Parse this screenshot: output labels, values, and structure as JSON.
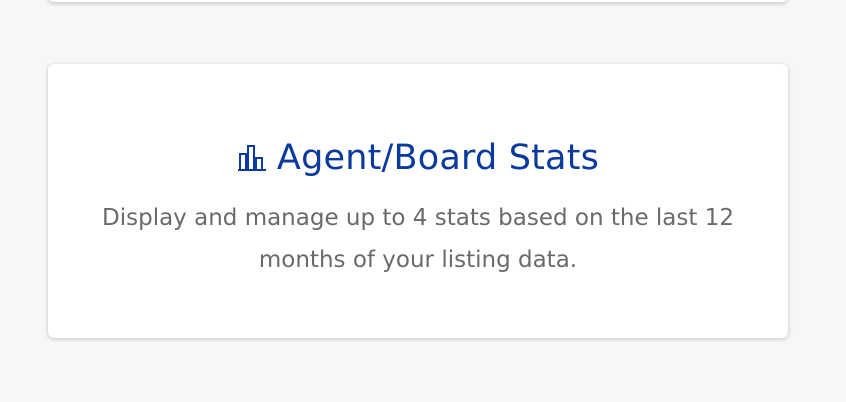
{
  "card": {
    "title": "Agent/Board Stats",
    "icon": "bar-chart-icon",
    "description": "Display and manage up to 4 stats based on the last 12 months of your listing data."
  },
  "colors": {
    "title": "#0a3a9e",
    "description": "#6a6a6a",
    "background": "#f7f7f7",
    "card": "#ffffff"
  }
}
